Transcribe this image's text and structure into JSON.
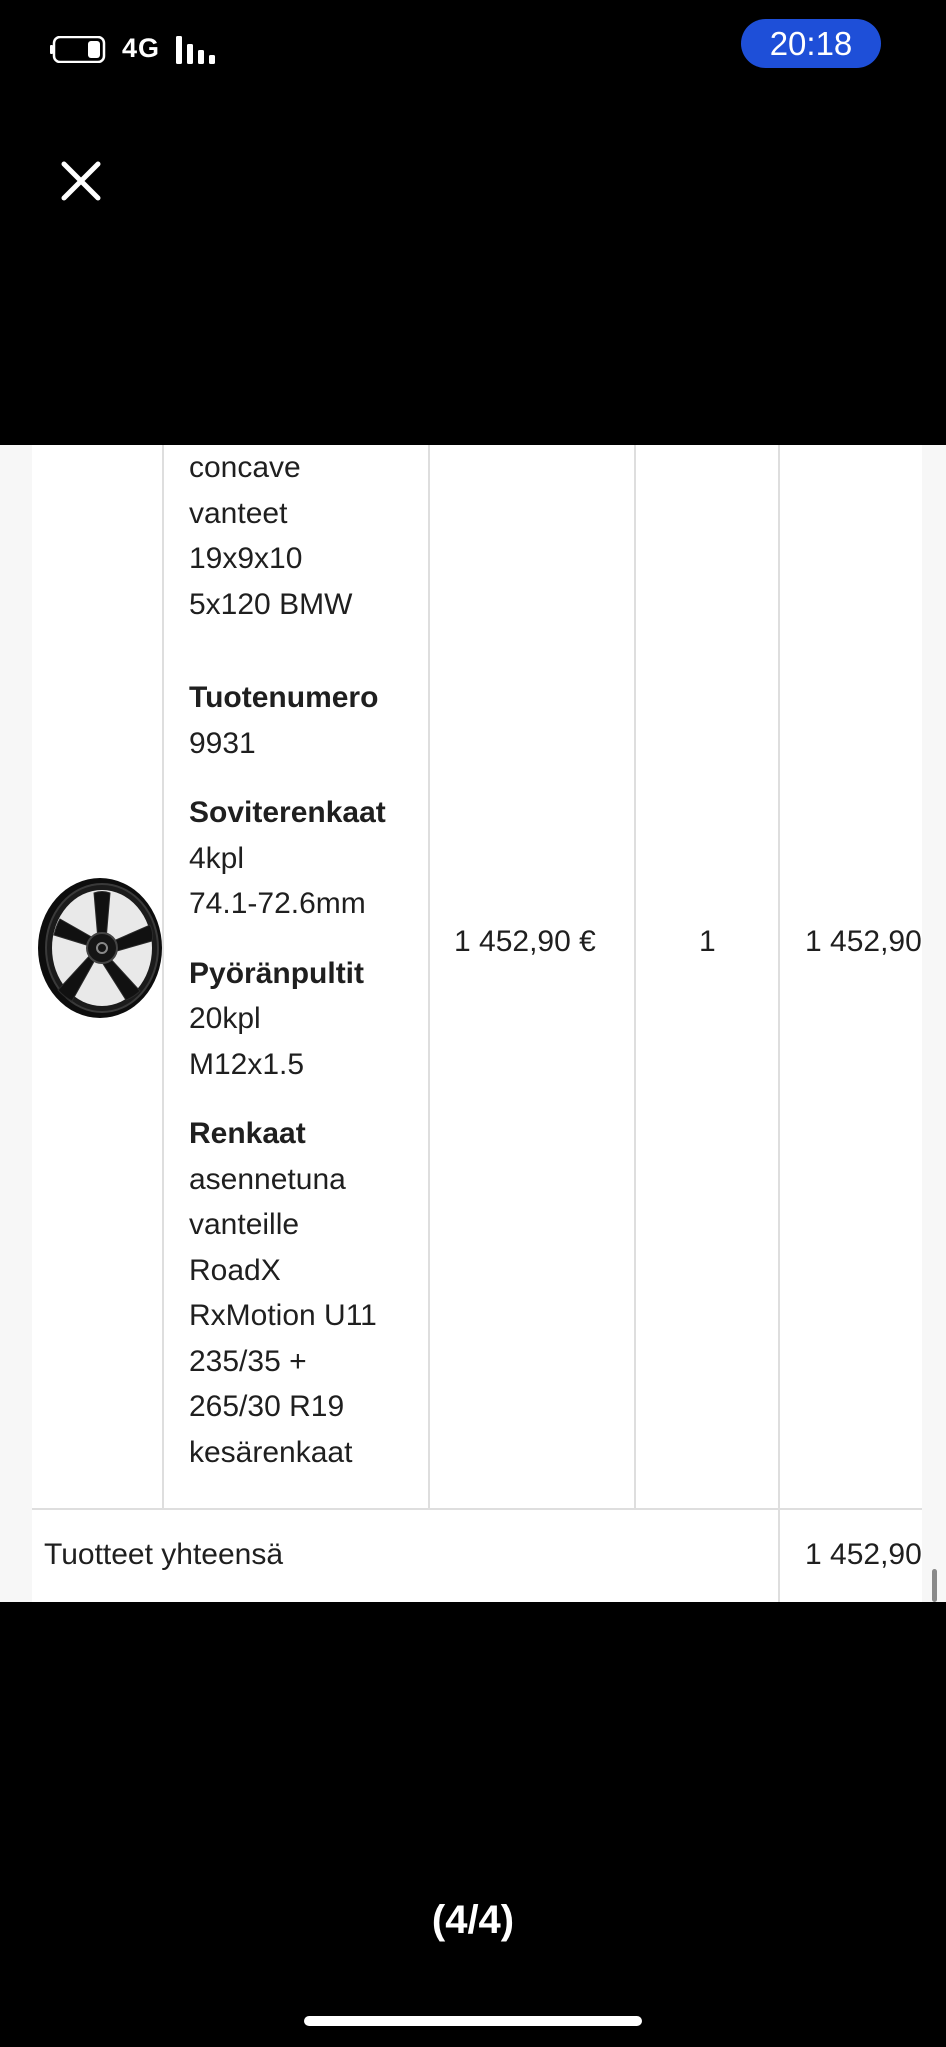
{
  "status_bar": {
    "network": "4G",
    "time": "20:18",
    "battery_icon": "battery-icon",
    "signal_icon": "signal-bars-icon",
    "pill_color": "#1e4fd8"
  },
  "viewer": {
    "close_icon": "close-icon",
    "page_counter": "(4/4)"
  },
  "order_table": {
    "product": {
      "image_icon": "black-alloy-wheel-image",
      "name_lines": [
        "concave",
        "vanteet",
        "19x9x10",
        "5x120 BMW"
      ],
      "product_number_label": "Tuotenumero",
      "product_number": "9931",
      "hub_rings_label": "Soviterenkaat",
      "hub_rings_lines": [
        "4kpl",
        "74.1-72.6mm"
      ],
      "bolts_label": "Pyöränpultit",
      "bolts_lines": [
        "20kpl",
        "M12x1.5"
      ],
      "tires_lines": [
        "Renkaat",
        "asennetuna",
        "vanteille",
        "RoadX",
        "RxMotion U11",
        "235/35 +",
        "265/30 R19",
        "kesärenkaat"
      ],
      "unit_price": "1 452,90 €",
      "quantity": "1",
      "line_total": "1 452,90"
    },
    "summary": {
      "label": "Tuotteet yhteensä",
      "value": "1 452,90"
    }
  }
}
